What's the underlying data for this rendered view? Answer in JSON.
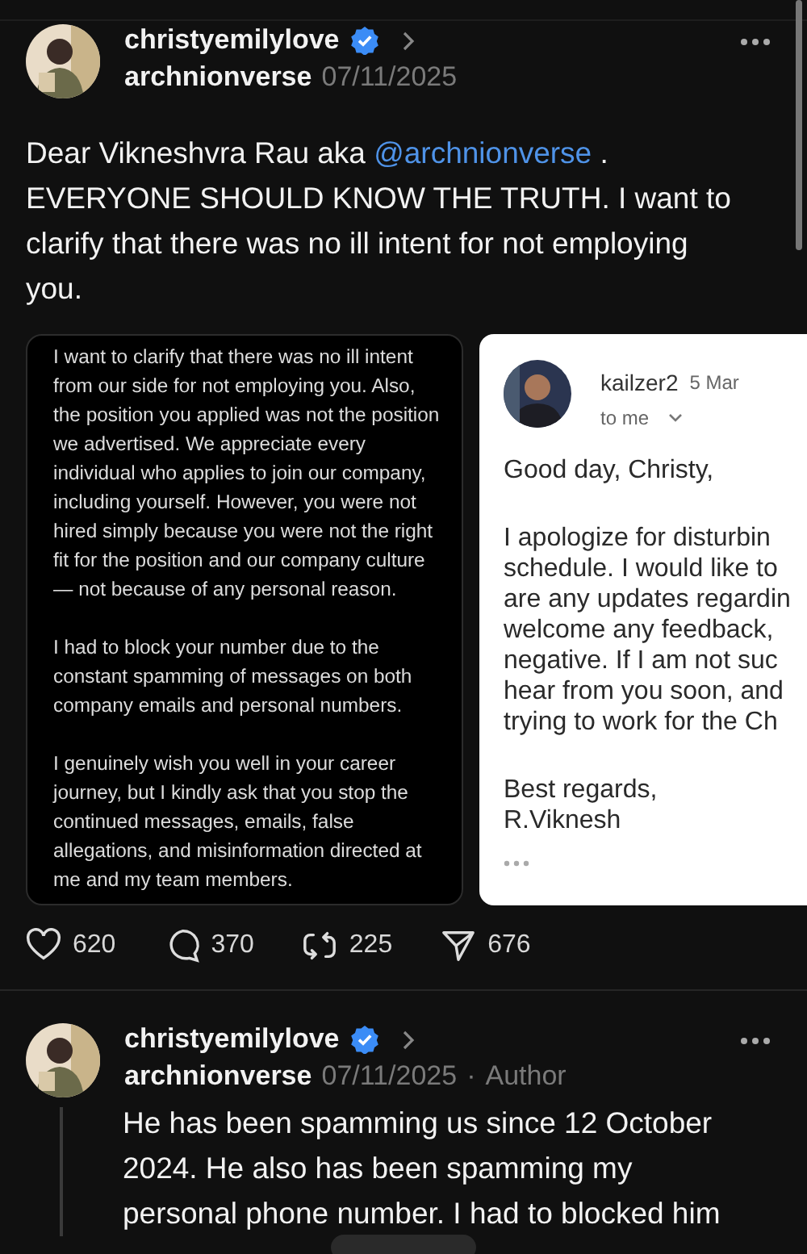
{
  "posts": [
    {
      "username": "christyemilylove",
      "verified": true,
      "handle": "archnionverse",
      "date": "07/11/2025",
      "body": [
        {
          "kind": "text",
          "text": "Dear Vikneshvra Rau aka "
        },
        {
          "kind": "mention",
          "text": "@archnionverse"
        },
        {
          "kind": "text",
          "text": " . EVERYONE SHOULD KNOW THE TRUTH. I want to clarify that there was no ill intent for not employing you."
        }
      ],
      "attachments": [
        {
          "kind": "note",
          "paragraphs": [
            "I want to clarify that there was no ill intent from our side for not employing you. Also, the position you applied was not the position we advertised. We appreciate every individual who applies to join our company, including yourself. However, you were not hired simply because you were not the right fit for the position and our company culture — not because of any personal reason.",
            "I had to block your number due to the constant spamming of messages on both company emails and personal numbers.",
            "I genuinely wish you well in your career journey, but I kindly ask that you stop the continued messages, emails, false allegations, and misinformation directed at me and my team members."
          ]
        },
        {
          "kind": "email",
          "sender": "kailzer2",
          "date": "5 Mar",
          "recipient": "to me",
          "greeting": "Good day, Christy,",
          "lines": [
            "I apologize for disturbin",
            "schedule. I would like to",
            "are any updates regardin",
            "welcome any feedback,",
            "negative. If I am not suc",
            "hear from you soon, and",
            "trying to work for the Ch"
          ],
          "closing": [
            "Best regards,",
            "R.Viknesh"
          ]
        }
      ],
      "actions": [
        {
          "kind": "like",
          "count": "620"
        },
        {
          "kind": "comment",
          "count": "370"
        },
        {
          "kind": "repost",
          "count": "225"
        },
        {
          "kind": "share",
          "count": "676"
        }
      ]
    },
    {
      "username": "christyemilylove",
      "verified": true,
      "handle": "archnionverse",
      "date": "07/11/2025",
      "separator": "·",
      "badge": "Author",
      "body": [
        {
          "kind": "text",
          "text": "He has been spamming us since 12 October 2024. He also has been spamming my personal phone number. I had to blocked him"
        }
      ]
    }
  ]
}
